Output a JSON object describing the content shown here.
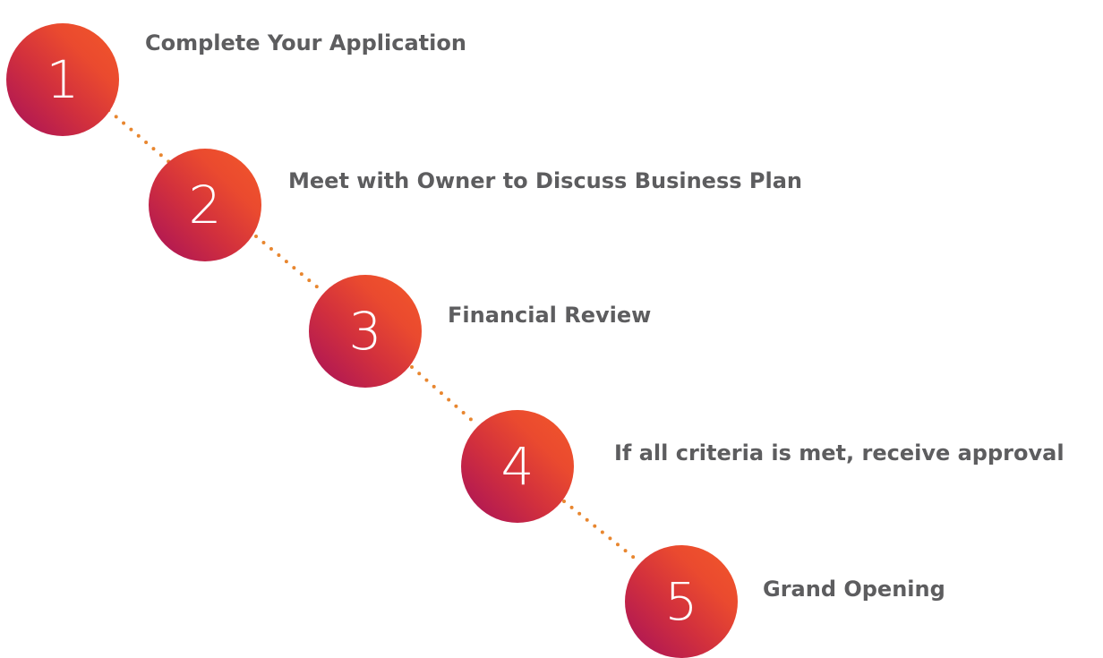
{
  "diagram": {
    "connector_color": "#e8862f",
    "circle_gradient": [
      "#f2572a",
      "#a6105a"
    ],
    "steps": [
      {
        "number": "1",
        "label": "Complete Your Application"
      },
      {
        "number": "2",
        "label": "Meet with Owner to Discuss Business Plan"
      },
      {
        "number": "3",
        "label": "Financial Review"
      },
      {
        "number": "4",
        "label": "If all criteria is met, receive approval"
      },
      {
        "number": "5",
        "label": "Grand Opening"
      }
    ]
  }
}
